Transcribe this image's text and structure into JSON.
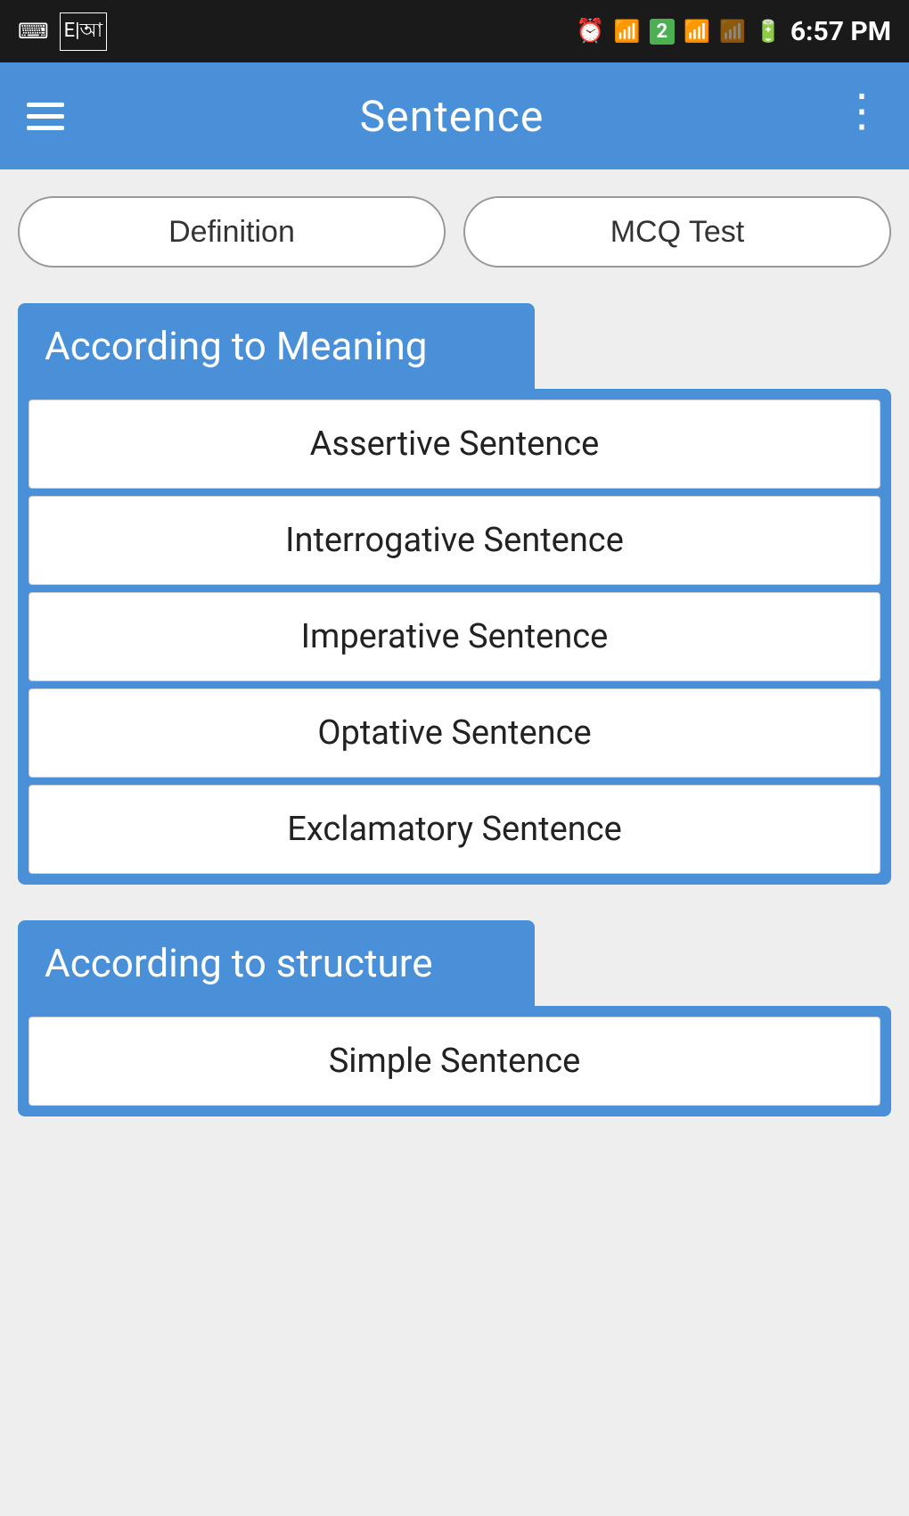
{
  "statusBar": {
    "time": "6:57 PM",
    "icons": {
      "usb": "⌨",
      "dictionary": "E|আ",
      "alarm": "⏰",
      "wifi": "WiFi",
      "sim": "2",
      "signal1": "▌▌▌▌",
      "signal2": "▌▌▌▌",
      "battery": "🔋"
    }
  },
  "appBar": {
    "title": "Sentence",
    "menuIcon": "hamburger",
    "moreIcon": "more-vertical"
  },
  "tabs": [
    {
      "id": "definition",
      "label": "Definition"
    },
    {
      "id": "mcq-test",
      "label": "MCQ Test"
    }
  ],
  "sections": [
    {
      "id": "according-to-meaning",
      "header": "According to Meaning",
      "items": [
        "Assertive Sentence",
        "Interrogative Sentence",
        "Imperative Sentence",
        "Optative Sentence",
        "Exclamatory Sentence"
      ]
    },
    {
      "id": "according-to-structure",
      "header": "According to structure",
      "items": [
        "Simple Sentence"
      ]
    }
  ],
  "colors": {
    "appBar": "#4a90d9",
    "sectionHeader": "#4a90d9",
    "sectionBody": "#4a90d9",
    "tabBorder": "#999999",
    "listItemBorder": "#cccccc",
    "background": "#eeeeee"
  }
}
